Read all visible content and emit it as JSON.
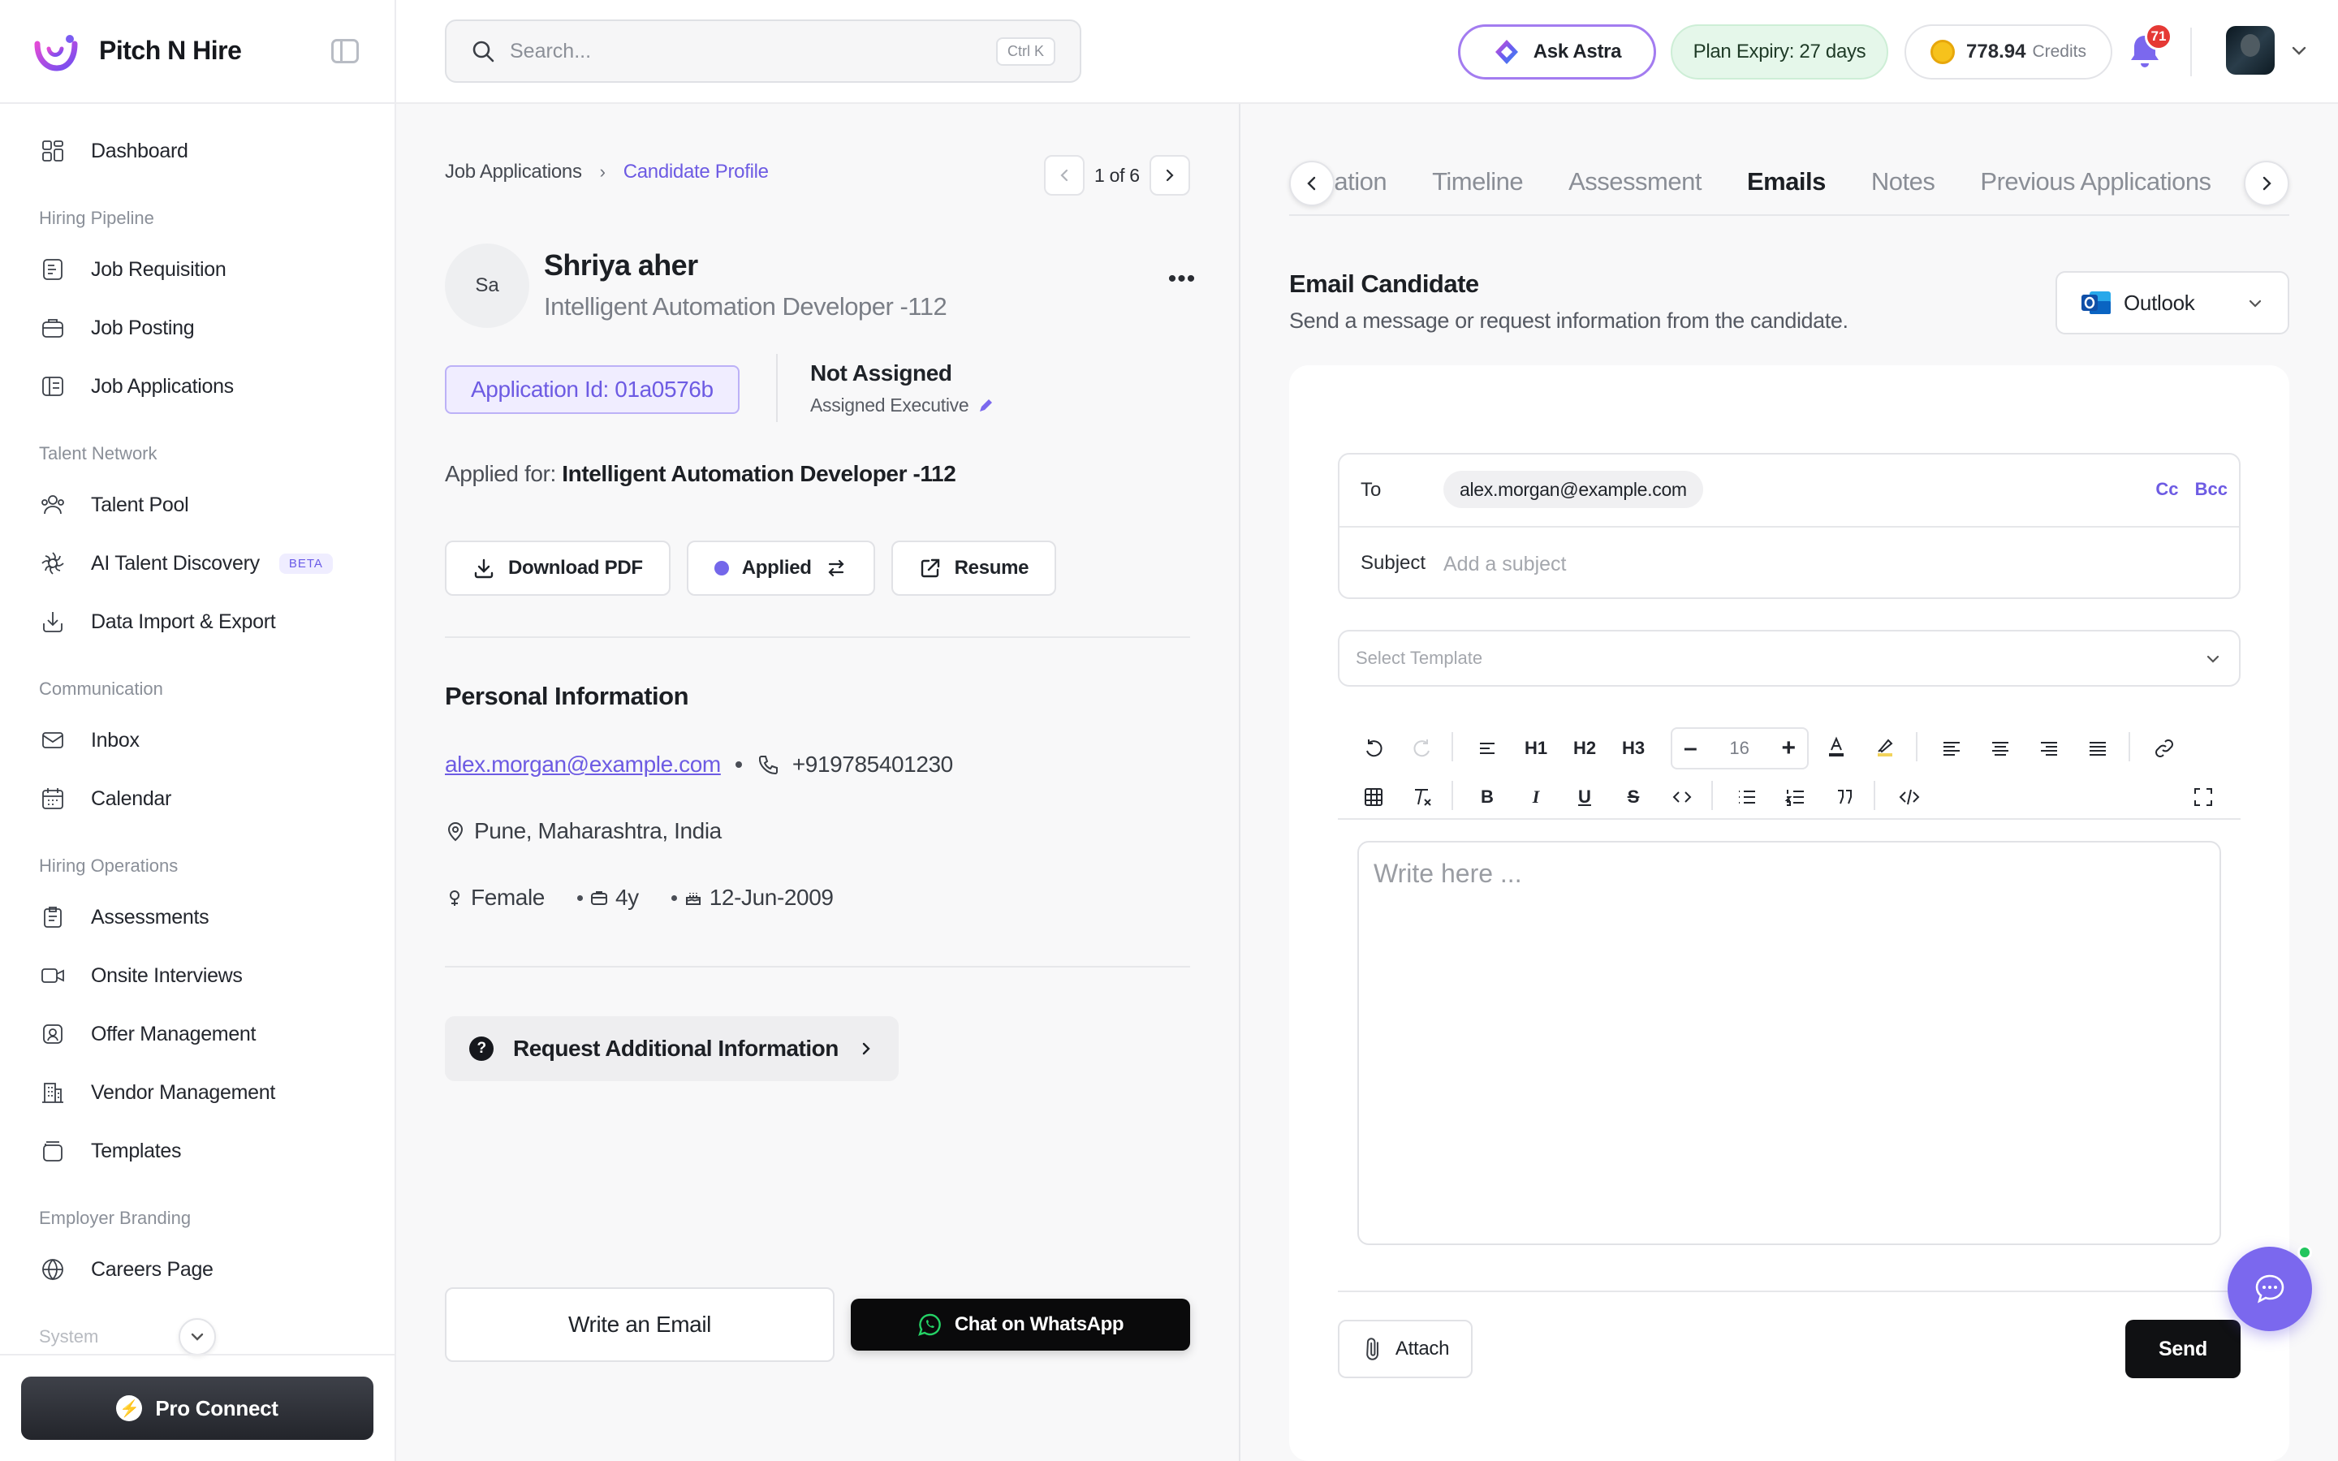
{
  "brand": {
    "name": "Pitch N Hire"
  },
  "sidebar": {
    "dashboard": "Dashboard",
    "sections": {
      "hiring_pipeline": "Hiring Pipeline",
      "talent_network": "Talent Network",
      "communication": "Communication",
      "hiring_operations": "Hiring Operations",
      "employer_branding": "Employer Branding",
      "system": "System"
    },
    "items": {
      "job_requisition": "Job Requisition",
      "job_posting": "Job Posting",
      "job_applications": "Job Applications",
      "talent_pool": "Talent Pool",
      "ai_talent_discovery": "AI Talent Discovery",
      "ai_badge": "BETA",
      "data_import_export": "Data Import & Export",
      "inbox": "Inbox",
      "calendar": "Calendar",
      "assessments": "Assessments",
      "onsite_interviews": "Onsite Interviews",
      "offer_management": "Offer Management",
      "vendor_management": "Vendor Management",
      "templates": "Templates",
      "careers_page": "Careers Page"
    },
    "pro_connect": "Pro Connect"
  },
  "topbar": {
    "search_placeholder": "Search...",
    "search_shortcut": "Ctrl K",
    "ask_astra": "Ask Astra",
    "plan_expiry": "Plan Expiry: 27 days",
    "credits_value": "778.94",
    "credits_label": "Credits",
    "notification_count": "71"
  },
  "breadcrumb": {
    "parent": "Job Applications",
    "current": "Candidate Profile"
  },
  "pager": {
    "text": "1 of 6"
  },
  "candidate": {
    "initials": "Sa",
    "name": "Shriya aher",
    "role": "Intelligent Automation Developer -112",
    "application_id": "Application Id: 01a0576b",
    "assigned_status": "Not Assigned",
    "assigned_label": "Assigned Executive",
    "applied_for_label": "Applied for:",
    "applied_for_value": "Intelligent Automation Developer -112"
  },
  "actions": {
    "download_pdf": "Download PDF",
    "status": "Applied",
    "resume": "Resume"
  },
  "personal": {
    "title": "Personal Information",
    "email": "alex.morgan@example.com",
    "phone": "+919785401230",
    "location": "Pune, Maharashtra, India",
    "gender": "Female",
    "experience": "4y",
    "dob": "12-Jun-2009"
  },
  "request_info": "Request Additional Information",
  "footer_actions": {
    "write_email": "Write an Email",
    "whatsapp": "Chat on WhatsApp"
  },
  "tabs": [
    "ication",
    "Timeline",
    "Assessment",
    "Emails",
    "Notes",
    "Previous Applications"
  ],
  "active_tab": "Emails",
  "email": {
    "title": "Email Candidate",
    "subtitle": "Send a message or request information from the candidate.",
    "provider": "Outlook",
    "to_label": "To",
    "to_value": "alex.morgan@example.com",
    "cc": "Cc",
    "bcc": "Bcc",
    "subject_label": "Subject",
    "subject_placeholder": "Add a subject",
    "template_placeholder": "Select Template",
    "font_size": "16",
    "body_placeholder": "Write here ...",
    "attach": "Attach",
    "send": "Send"
  },
  "toolbar_labels": {
    "h1": "H1",
    "h2": "H2",
    "h3": "H3",
    "bold": "B",
    "italic": "I",
    "underline": "U",
    "strike": "S"
  },
  "colors": {
    "accent": "#6d5be3",
    "fab": "#7b68ee",
    "badge": "#e53935",
    "online": "#22c55e"
  }
}
